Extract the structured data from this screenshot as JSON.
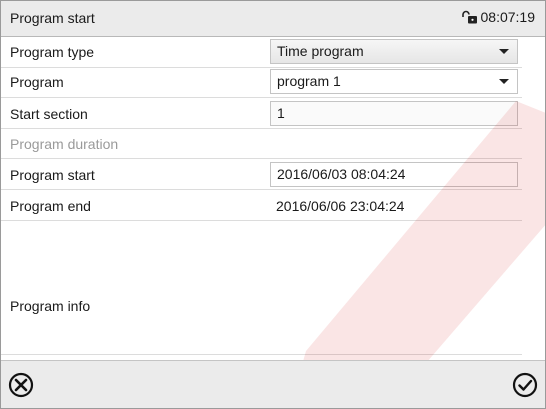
{
  "header": {
    "title": "Program start",
    "time": "08:07:19",
    "icon": "unlocked-lock-icon"
  },
  "rows": {
    "program_type": {
      "label": "Program type",
      "value": "Time program"
    },
    "program": {
      "label": "Program",
      "value": "program 1"
    },
    "start_section": {
      "label": "Start section",
      "value": "1"
    },
    "program_duration": {
      "label": "Program duration"
    },
    "program_start": {
      "label": "Program start",
      "value": "2016/06/03 08:04:24"
    },
    "program_end": {
      "label": "Program end",
      "value": "2016/06/06 23:04:24"
    },
    "program_info": {
      "label": "Program info"
    }
  },
  "footer": {
    "cancel_icon": "cancel-circle-icon",
    "confirm_icon": "checkmark-circle-icon"
  },
  "colors": {
    "header_bg": "#ebebeb",
    "dim_label": "#9a9a9a",
    "watermark": "#cc0000"
  }
}
